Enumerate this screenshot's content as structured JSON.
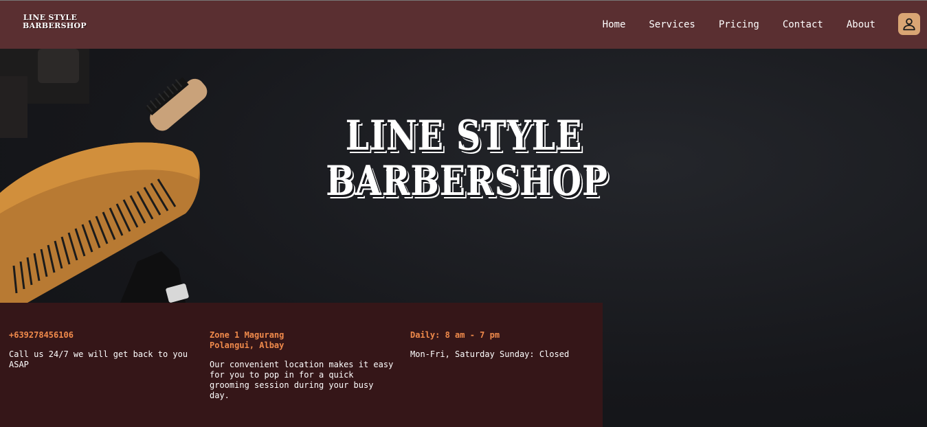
{
  "navbar": {
    "logo_line1": "LINE STYLE",
    "logo_line2": "BARBERSHOP",
    "links": [
      "Home",
      "Services",
      "Pricing",
      "Contact",
      "About"
    ],
    "user_icon": "user-icon"
  },
  "hero": {
    "title_line1": "LINE STYLE",
    "title_line2": "BARBERSHOP"
  },
  "info": {
    "phone": {
      "heading": "+639278456106",
      "text": "Call us 24/7 we will get back to you ASAP"
    },
    "location": {
      "heading_line1": "Zone 1 Magurang",
      "heading_line2": "Polangui, Albay",
      "text": "Our convenient location makes it easy for you to pop in for a quick grooming session during your busy day."
    },
    "hours": {
      "heading": "Daily: 8 am - 7 pm",
      "text": "Mon-Fri, Saturday Sunday: Closed"
    }
  },
  "colors": {
    "navbar_bg": "#5a2f31",
    "info_bg": "#351618",
    "accent": "#f08a4b",
    "user_button": "#d9a574"
  }
}
